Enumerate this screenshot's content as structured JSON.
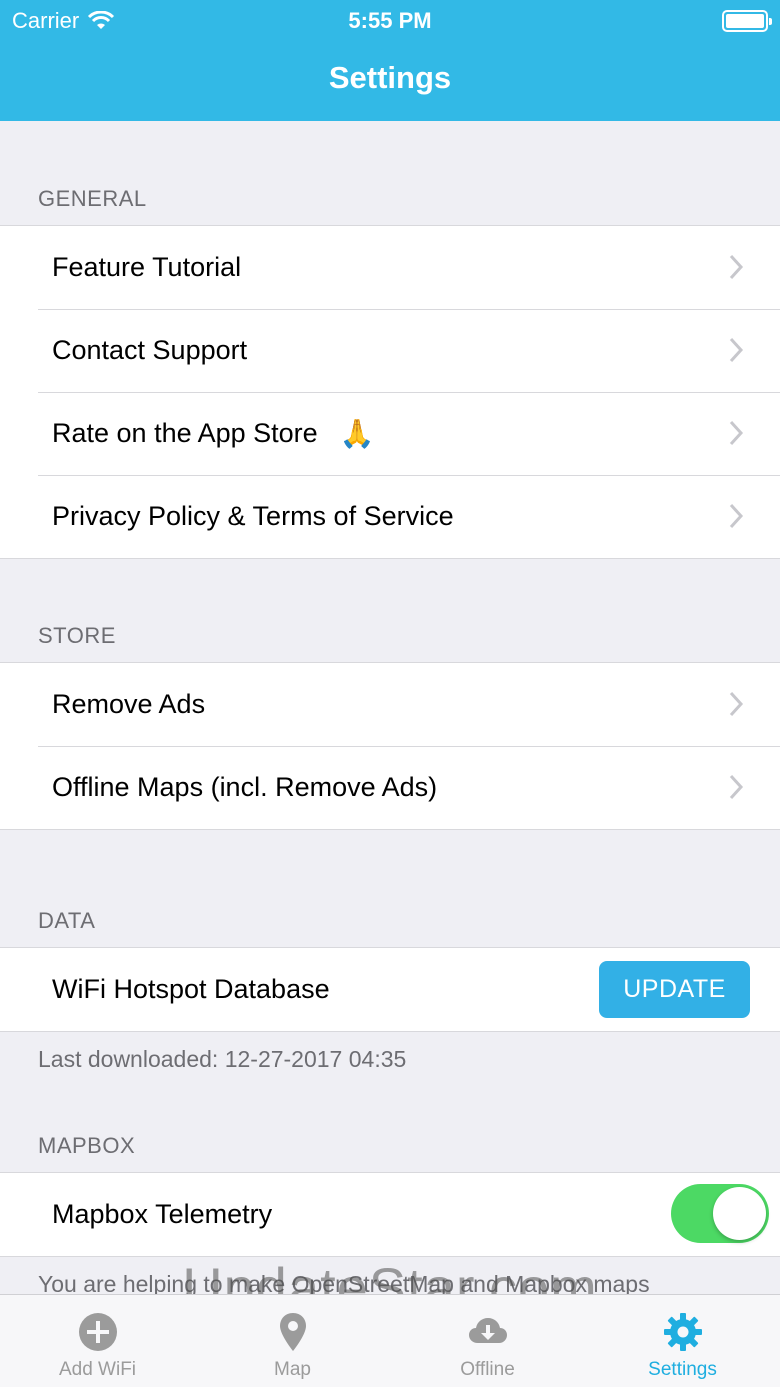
{
  "status_bar": {
    "carrier": "Carrier",
    "time": "5:55 PM"
  },
  "nav": {
    "title": "Settings"
  },
  "general": {
    "header": "GENERAL",
    "items": [
      {
        "label": "Feature Tutorial"
      },
      {
        "label": "Contact Support"
      },
      {
        "label": "Rate on the App Store",
        "emoji": "🙏"
      },
      {
        "label": "Privacy Policy & Terms of Service"
      }
    ]
  },
  "store": {
    "header": "STORE",
    "items": [
      {
        "label": "Remove Ads"
      },
      {
        "label": "Offline Maps (incl. Remove Ads)"
      }
    ]
  },
  "data": {
    "header": "DATA",
    "row_label": "WiFi Hotspot Database",
    "button_label": "UPDATE",
    "footnote": "Last downloaded: 12-27-2017 04:35"
  },
  "mapbox": {
    "header": "MAPBOX",
    "row_label": "Mapbox Telemetry",
    "toggle_on": true,
    "footnote": "You are helping to make OpenStreetMap and Mapbox maps"
  },
  "watermark": "UpdateStar.com",
  "tabs": [
    {
      "label": "Add WiFi",
      "icon": "plus-circle-icon"
    },
    {
      "label": "Map",
      "icon": "map-pin-icon"
    },
    {
      "label": "Offline",
      "icon": "cloud-download-icon"
    },
    {
      "label": "Settings",
      "icon": "gear-icon",
      "active": true
    }
  ],
  "colors": {
    "accent": "#32b9e6",
    "toggle_on": "#4cd964",
    "tab_active": "#1faee0",
    "tab_inactive": "#9b9b9b"
  }
}
